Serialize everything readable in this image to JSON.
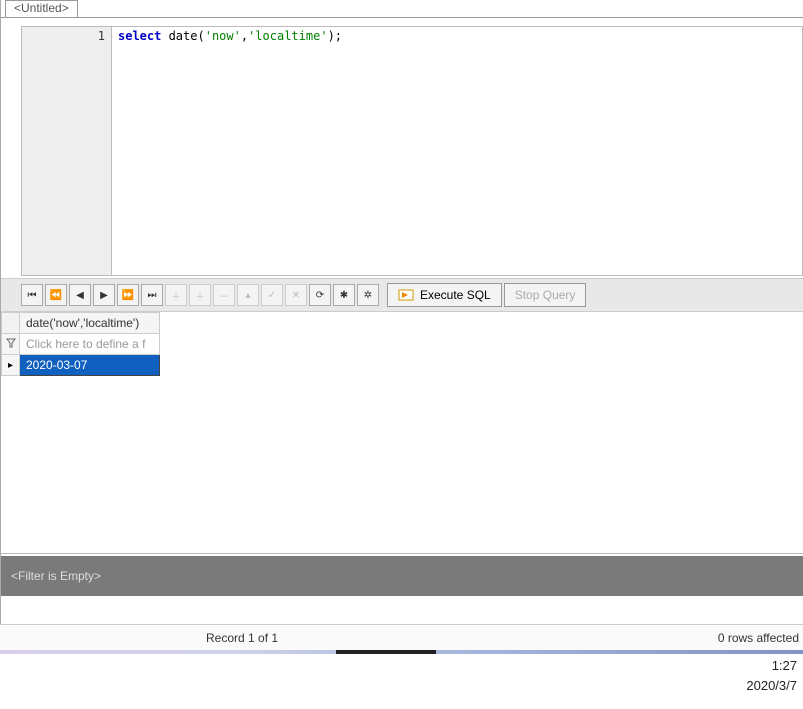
{
  "tab": {
    "title": "<Untitled>"
  },
  "editor": {
    "line_number": "1",
    "tok_select": "select",
    "tok_date": " date(",
    "tok_str1": "'now'",
    "tok_comma": ",",
    "tok_str2": "'localtime'",
    "tok_end": ");"
  },
  "toolbar": {
    "execute_label": "Execute SQL",
    "stop_label": "Stop Query"
  },
  "results": {
    "header": "date('now','localtime')",
    "filter_placeholder": "Click here to define a f",
    "row_marker": "▸",
    "filter_marker": "🝖",
    "value": "2020-03-07"
  },
  "filter_bar": {
    "text": "<Filter is Empty>"
  },
  "status": {
    "record": "Record 1 of 1",
    "rows": "0 rows affected"
  },
  "clock": {
    "time": "1:27",
    "date": "2020/3/7"
  }
}
